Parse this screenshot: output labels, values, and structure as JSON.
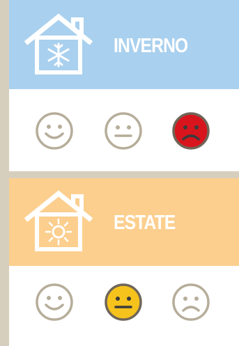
{
  "winter": {
    "title": "INVERNO",
    "icon": "house-snowflake-icon",
    "color": "#a9d0ee",
    "faces": [
      {
        "mood": "happy",
        "selected": false,
        "color": "#ffffff"
      },
      {
        "mood": "neutral",
        "selected": false,
        "color": "#ffffff"
      },
      {
        "mood": "sad",
        "selected": true,
        "color": "#d8151c"
      }
    ]
  },
  "summer": {
    "title": "ESTATE",
    "icon": "house-sun-icon",
    "color": "#fccf8f",
    "faces": [
      {
        "mood": "happy",
        "selected": false,
        "color": "#ffffff"
      },
      {
        "mood": "neutral",
        "selected": true,
        "color": "#f6c21c"
      },
      {
        "mood": "sad",
        "selected": false,
        "color": "#ffffff"
      }
    ]
  },
  "colors": {
    "frame": "#d7cfbe",
    "face_outline": "#b6ad9a",
    "face_outline_selected": "#6f6659",
    "selected_face_features": "#3b3b3b"
  }
}
